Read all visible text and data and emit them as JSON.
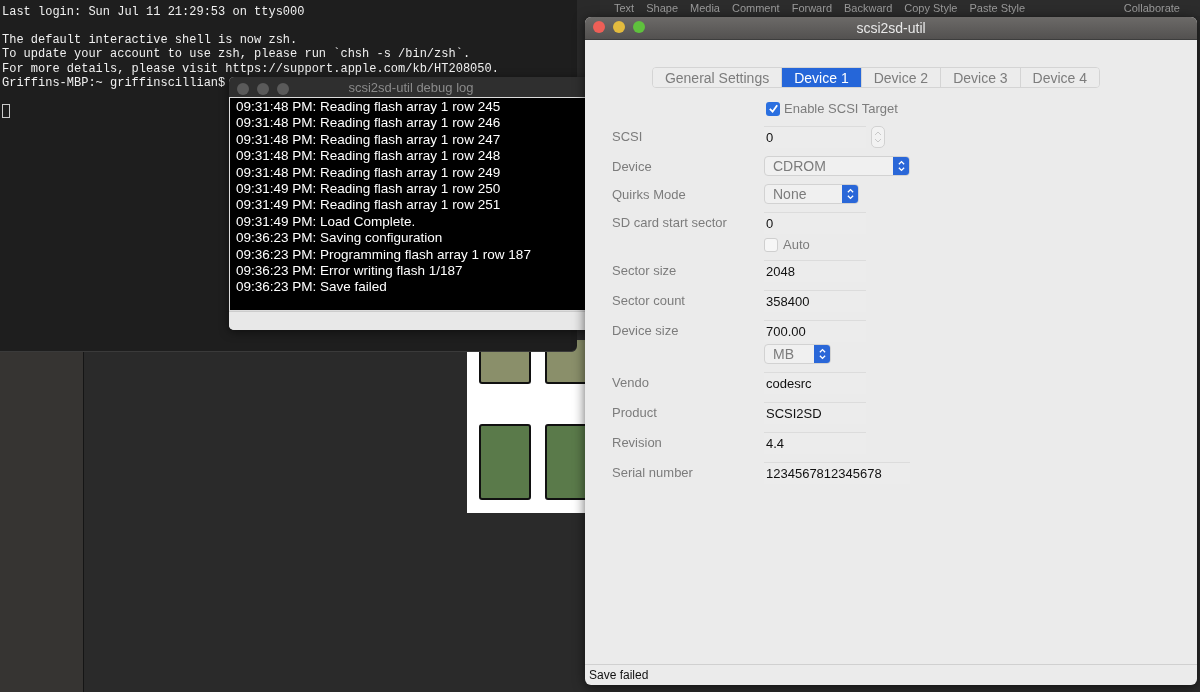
{
  "background_app": {
    "toolbar_items": [
      "Text",
      "Shape",
      "Media",
      "Comment",
      "Forward",
      "Backward",
      "Copy Style",
      "Paste Style",
      "Collaborate"
    ]
  },
  "terminal": {
    "blocks": [
      [
        "Last login: Sun Jul 11 21:29:53 on ttys000"
      ],
      [
        "The default interactive shell is now zsh.",
        "To update your account to use zsh, please run `chsh -s /bin/zsh`.",
        "For more details, please visit https://support.apple.com/kb/HT208050.",
        "Griffins-MBP:~ griffinscillian$"
      ]
    ]
  },
  "debug_log": {
    "title": "scsi2sd-util debug log",
    "lines": [
      "09:31:48 PM: Reading flash array 1 row 245",
      "09:31:48 PM: Reading flash array 1 row 246",
      "09:31:48 PM: Reading flash array 1 row 247",
      "09:31:48 PM: Reading flash array 1 row 248",
      "09:31:48 PM: Reading flash array 1 row 249",
      "09:31:49 PM: Reading flash array 1 row 250",
      "09:31:49 PM: Reading flash array 1 row 251",
      "09:31:49 PM: Load Complete.",
      "09:36:23 PM: Saving configuration",
      "09:36:23 PM: Programming flash array 1 row 187",
      "09:36:23 PM: Error writing flash 1/187",
      "09:36:23 PM: Save failed"
    ]
  },
  "window": {
    "title": "scsi2sd-util",
    "tabs": [
      {
        "label": "General Settings",
        "selected": false
      },
      {
        "label": "Device 1",
        "selected": true
      },
      {
        "label": "Device 2",
        "selected": false
      },
      {
        "label": "Device 3",
        "selected": false
      },
      {
        "label": "Device 4",
        "selected": false
      }
    ],
    "enable": {
      "label": "Enable SCSI Target",
      "checked": true
    },
    "fields": [
      {
        "label": "SCSI",
        "kind": "stepper",
        "value": "0"
      },
      {
        "label": "Device",
        "kind": "select",
        "value": "CDROM"
      },
      {
        "label": "Quirks Mode",
        "kind": "select",
        "value": "None"
      },
      {
        "label": "SD card start sector",
        "kind": "text",
        "value": "0",
        "option": {
          "label": "Auto",
          "checked": false
        }
      },
      {
        "label": "Sector size",
        "kind": "text",
        "value": "2048"
      },
      {
        "label": "Sector count",
        "kind": "text",
        "value": "358400"
      },
      {
        "label": "Device size",
        "kind": "text",
        "value": "700.00",
        "unit": "MB"
      },
      {
        "label": "Vendo",
        "kind": "text",
        "value": "codesrc"
      },
      {
        "label": "Product",
        "kind": "text",
        "value": "SCSI2SD"
      },
      {
        "label": "Revision",
        "kind": "text",
        "value": "4.4"
      },
      {
        "label": "Serial number",
        "kind": "text",
        "value": "1234567812345678"
      }
    ],
    "status_bar": "Save failed"
  }
}
